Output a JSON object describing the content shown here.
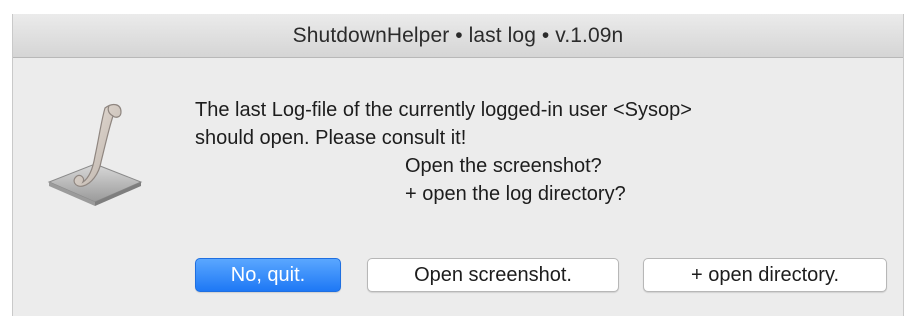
{
  "window": {
    "title": "ShutdownHelper • last log • v.1.09n"
  },
  "icon": {
    "name": "script-scroll-icon"
  },
  "message": {
    "line1": "The last Log-file of the currently logged-in user <Sysop>",
    "line2": "should open. Please consult it!",
    "line3": "Open the screenshot?",
    "line4": "+ open the log directory?"
  },
  "buttons": {
    "quit_label": "No, quit.",
    "screenshot_label": "Open screenshot.",
    "directory_label": "+ open directory."
  },
  "colors": {
    "primary_button": "#1e78f5",
    "window_background": "#ececec"
  }
}
